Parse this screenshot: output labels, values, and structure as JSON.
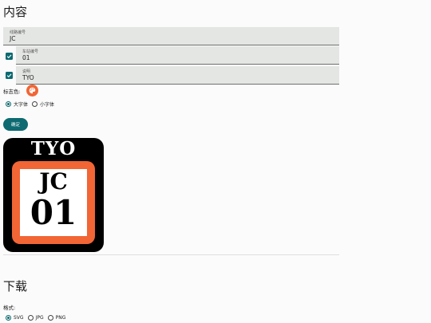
{
  "content": {
    "heading": "内容",
    "line_field": {
      "label": "线路编号",
      "value": "JC"
    },
    "station_field": {
      "label": "车站编号",
      "value": "01",
      "checked": true
    },
    "desc_field": {
      "label": "说明",
      "value": "TYO",
      "checked": true
    },
    "color_label": "标志色:",
    "color_value": "#f26535",
    "font_options": [
      {
        "label": "大字体",
        "selected": true
      },
      {
        "label": "小字体",
        "selected": false
      }
    ],
    "confirm_label": "确定"
  },
  "preview": {
    "top_text": "TYO",
    "line_code": "JC",
    "station_number": "01",
    "accent": "#f26535"
  },
  "download": {
    "heading": "下载",
    "format_label": "格式:",
    "formats": [
      {
        "label": "SVG",
        "selected": true
      },
      {
        "label": "JPG",
        "selected": false
      },
      {
        "label": "PNG",
        "selected": false
      }
    ]
  },
  "colors": {
    "primary": "#0d6a71",
    "accent": "#f26535"
  }
}
